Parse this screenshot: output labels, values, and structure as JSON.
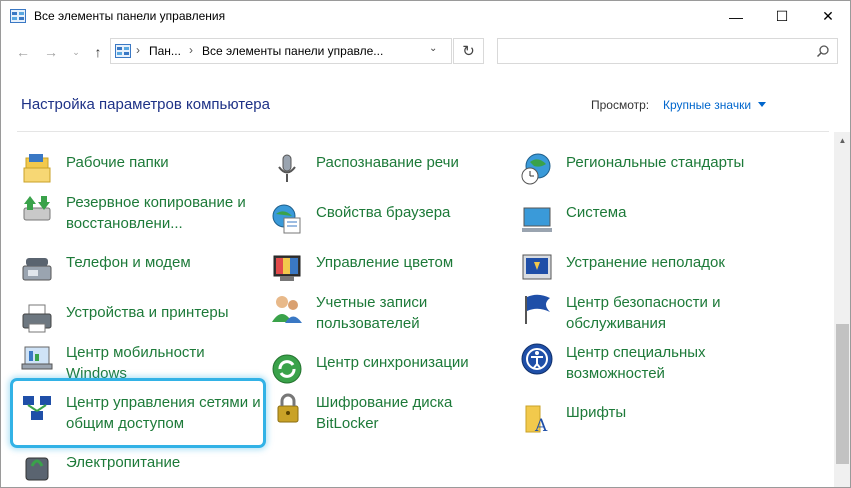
{
  "window": {
    "title": "Все элементы панели управления",
    "controls": {
      "minimize": "—",
      "maximize": "☐",
      "close": "✕"
    }
  },
  "nav": {
    "back": "←",
    "forward": "→",
    "recent": "⌄",
    "up": "↑",
    "breadcrumbs": [
      "Пан...",
      "Все элементы панели управле..."
    ],
    "separator": "›",
    "dropdown": "⌄",
    "refresh": "↻",
    "search_value": ""
  },
  "header": {
    "title": "Настройка параметров компьютера",
    "view_label": "Просмотр:",
    "view_value": "Крупные значки"
  },
  "items": [
    {
      "label": "Рабочие папки",
      "icon": "work-folders-icon"
    },
    {
      "label": "Распознавание речи",
      "icon": "microphone-icon"
    },
    {
      "label": "Региональные стандарты",
      "icon": "globe-clock-icon"
    },
    {
      "label": "Резервное копирование и восстановлени...",
      "icon": "backup-icon"
    },
    {
      "label": "Свойства браузера",
      "icon": "browser-settings-icon"
    },
    {
      "label": "Система",
      "icon": "computer-icon"
    },
    {
      "label": "Телефон и модем",
      "icon": "phone-modem-icon"
    },
    {
      "label": "Управление цветом",
      "icon": "color-management-icon"
    },
    {
      "label": "Устранение неполадок",
      "icon": "troubleshooting-icon"
    },
    {
      "label": "Устройства и принтеры",
      "icon": "printer-icon"
    },
    {
      "label": "Учетные записи пользователей",
      "icon": "users-icon"
    },
    {
      "label": "Центр безопасности и обслуживания",
      "icon": "flag-icon"
    },
    {
      "label": "Центр мобильности Windows",
      "icon": "mobility-icon"
    },
    {
      "label": "Центр синхронизации",
      "icon": "sync-icon"
    },
    {
      "label": "Центр специальных возможностей",
      "icon": "accessibility-icon"
    },
    {
      "label": "Центр управления сетями и общим доступом",
      "icon": "network-icon"
    },
    {
      "label": "Шифрование диска BitLocker",
      "icon": "bitlocker-icon"
    },
    {
      "label": "Шрифты",
      "icon": "fonts-icon"
    },
    {
      "label": "Электропитание",
      "icon": "power-icon"
    }
  ],
  "colors": {
    "link_green": "#1d7a39",
    "title_blue": "#1e3287",
    "accent_blue": "#0066cc",
    "highlight": "#32b2e6"
  }
}
